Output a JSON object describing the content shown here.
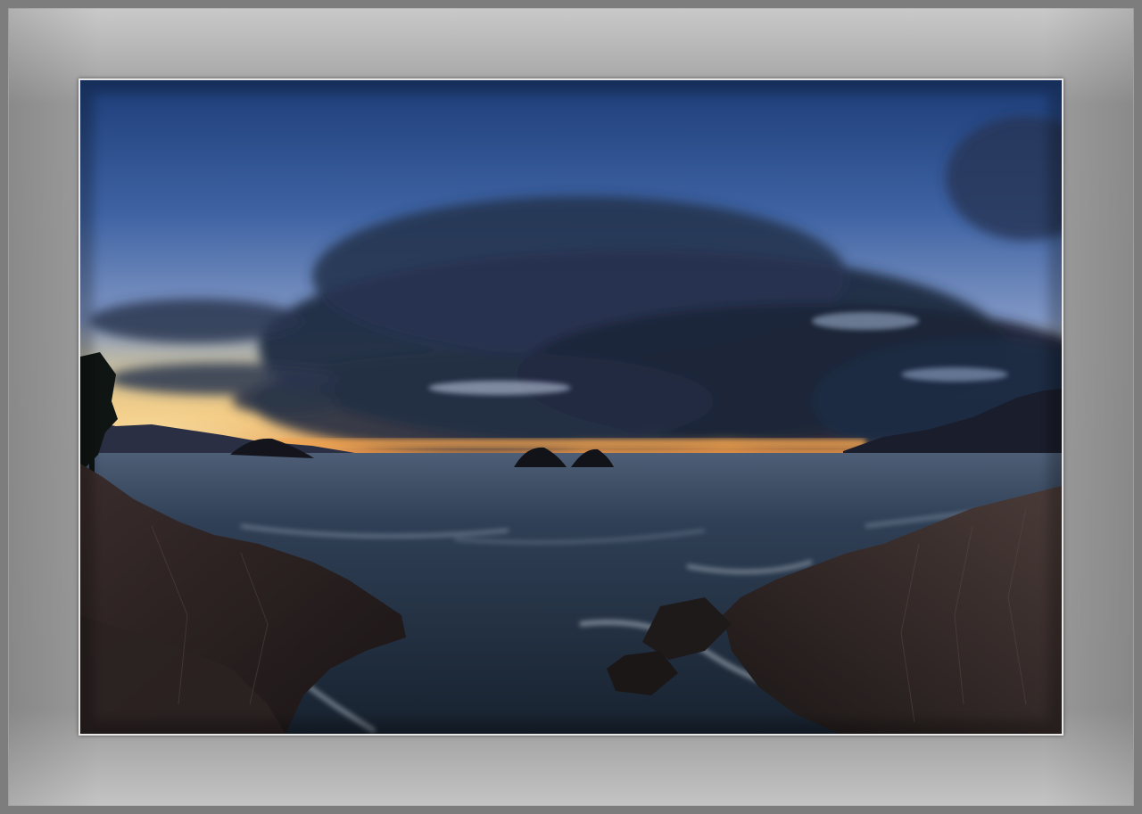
{
  "scene": {
    "subject": "seascape-dusk",
    "colors": {
      "sky_top": "#2b4f8f",
      "sky_mid": "#4f6ea8",
      "horizon_glow": "#f3c070",
      "horizon_orange": "#e7873c",
      "cloud_dark": "#1f2a3f",
      "sea": "#1e2d40",
      "rock": "#231d1d",
      "mat": "#a8a8a8",
      "outer_frame": "#7d7d7d"
    }
  }
}
